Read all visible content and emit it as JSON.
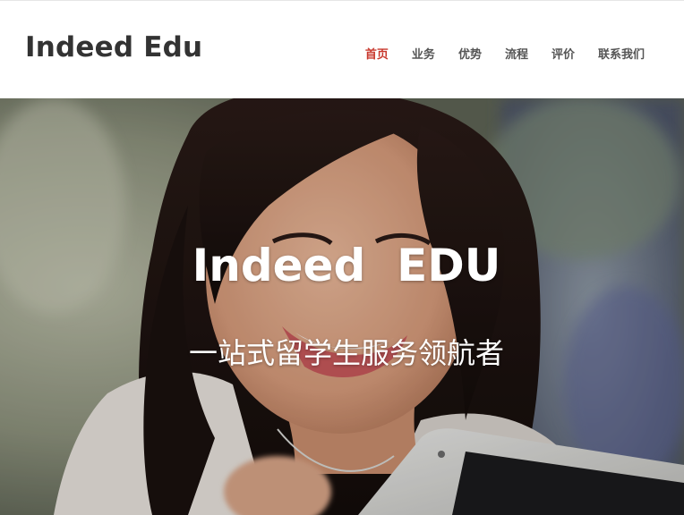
{
  "header": {
    "brand": "Indeed Edu",
    "nav": [
      {
        "label": "首页",
        "active": true
      },
      {
        "label": "业务",
        "active": false
      },
      {
        "label": "优势",
        "active": false
      },
      {
        "label": "流程",
        "active": false
      },
      {
        "label": "评价",
        "active": false
      },
      {
        "label": "联系我们",
        "active": false
      }
    ]
  },
  "hero": {
    "title": "Indeed  EDU",
    "subtitle": "一站式留学生服务领航者"
  },
  "colors": {
    "brand_text": "#333333",
    "nav_text": "#555555",
    "nav_active": "#c8382d",
    "hero_text": "#ffffff"
  }
}
